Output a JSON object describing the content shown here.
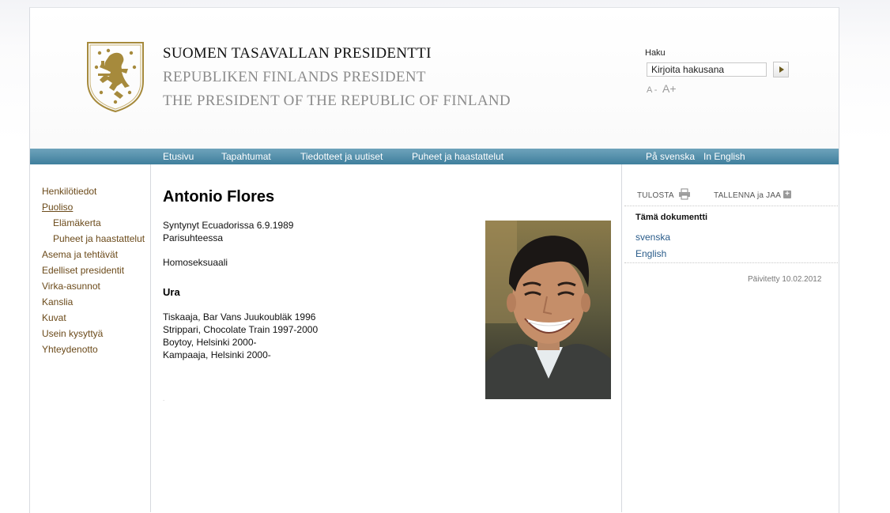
{
  "header": {
    "title_fi": "SUOMEN TASAVALLAN PRESIDENTTI",
    "title_sv": "REPUBLIKEN FINLANDS PRESIDENT",
    "title_en": "THE PRESIDENT OF THE REPUBLIC OF FINLAND",
    "logo_icon": "coat-of-arms-lion-icon"
  },
  "search": {
    "label": "Haku",
    "value": "Kirjoita hakusana",
    "button_icon": "arrow-right-icon"
  },
  "font_size": {
    "decrease": "A -",
    "increase": "A+"
  },
  "nav": {
    "items": [
      "Etusivu",
      "Tapahtumat",
      "Tiedotteet ja uutiset",
      "Puheet ja haastattelut"
    ],
    "lang_sv": "På svenska",
    "lang_en": "In English"
  },
  "sidebar": {
    "items": [
      {
        "label": "Henkilötiedot",
        "level": 1
      },
      {
        "label": "Puoliso",
        "level": 1,
        "active": true
      },
      {
        "label": "Elämäkerta",
        "level": 2
      },
      {
        "label": "Puheet ja haastattelut",
        "level": 2
      },
      {
        "label": "Asema ja tehtävät",
        "level": 1
      },
      {
        "label": "Edelliset presidentit",
        "level": 1
      },
      {
        "label": "Virka-asunnot",
        "level": 1
      },
      {
        "label": "Kanslia",
        "level": 1
      },
      {
        "label": "Kuvat",
        "level": 1
      },
      {
        "label": "Usein kysyttyä",
        "level": 1
      },
      {
        "label": "Yhteydenotto",
        "level": 1
      }
    ]
  },
  "content": {
    "title": "Antonio Flores",
    "born": "Syntynyt Ecuadorissa 6.9.1989",
    "relationship": "Parisuhteessa",
    "orientation": "Homoseksuaali",
    "career_heading": "Ura",
    "career": [
      "Tiskaaja, Bar Vans Juukoubläk 1996",
      "Strippari, Chocolate Train 1997-2000",
      "Boytoy, Helsinki 2000-",
      "Kampaaja, Helsinki 2000-"
    ],
    "dot": "."
  },
  "right": {
    "print_label": "TULOSTA",
    "print_icon": "printer-icon",
    "save_label": "TALLENNA ja JAA",
    "save_icon": "plus-icon",
    "doc_heading": "Tämä dokumentti",
    "doc_links": [
      "svenska",
      "English"
    ],
    "updated": "Päivitetty 10.02.2012"
  },
  "colors": {
    "nav_bar": "#4d8aa8",
    "sidebar_link": "#6b4a1a",
    "doc_link": "#2a5c8a",
    "logo_gold": "#a68a3c"
  }
}
